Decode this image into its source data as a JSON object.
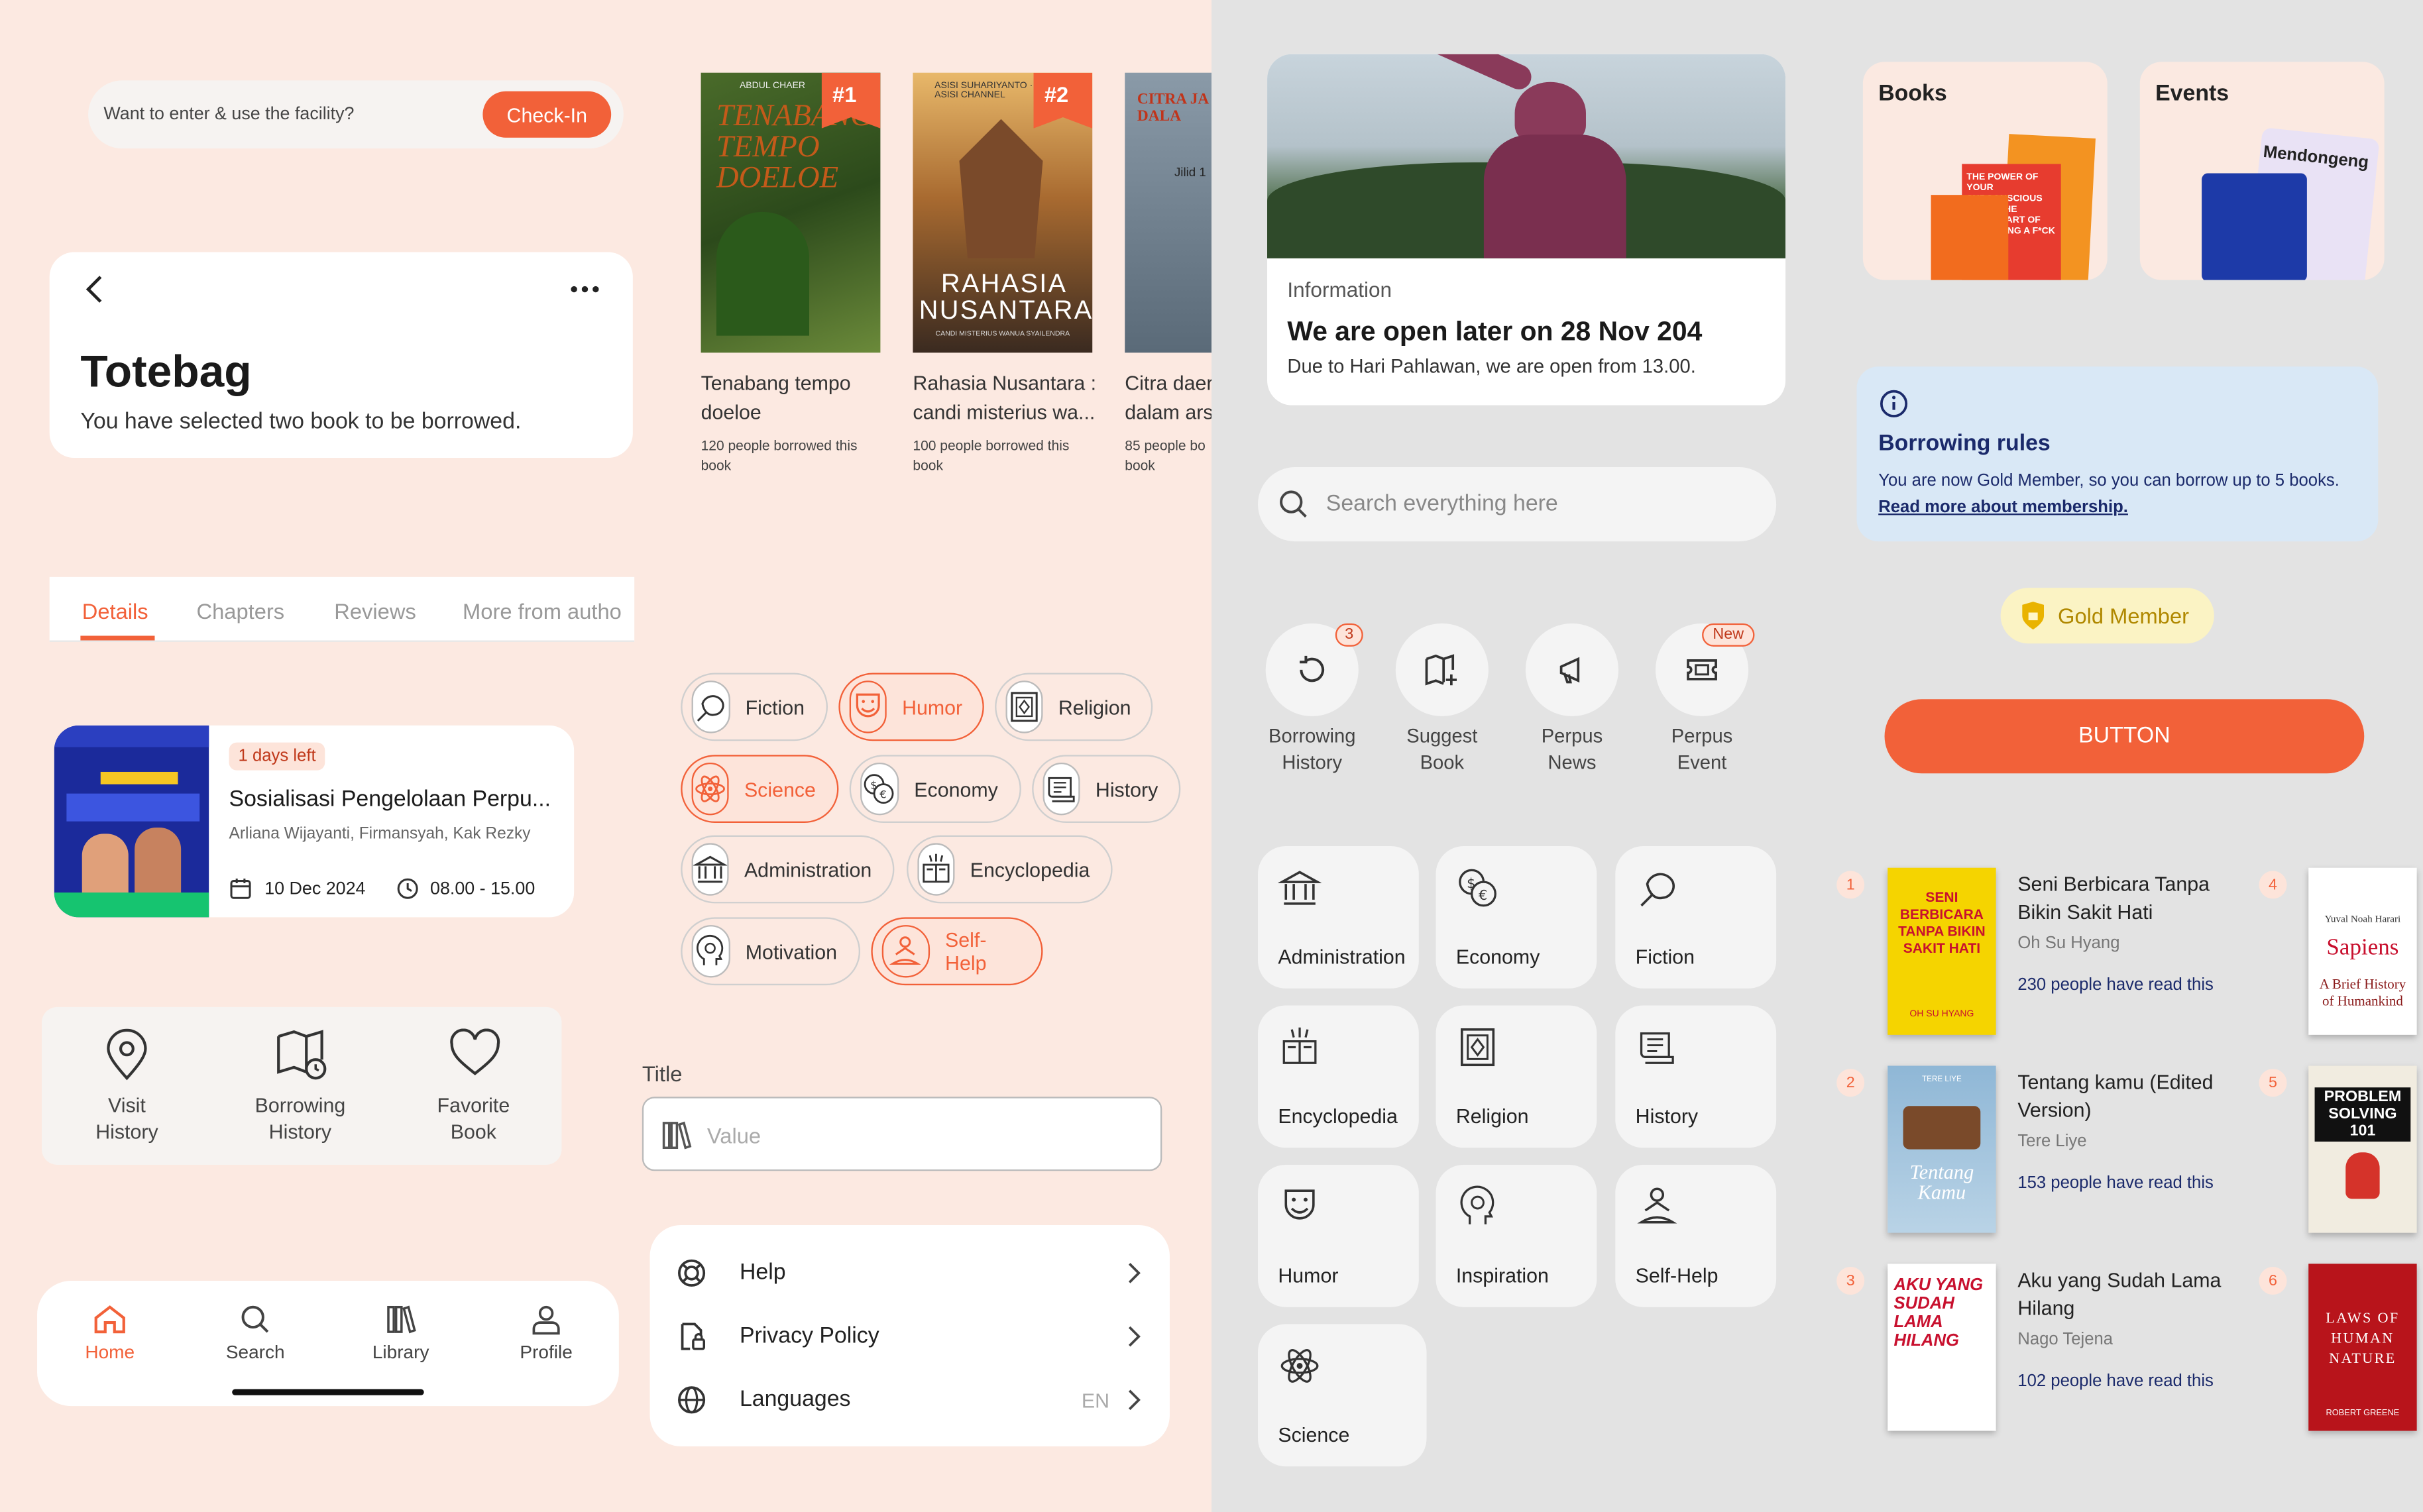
{
  "checkin": {
    "prompt": "Want to enter & use the facility?",
    "button": "Check-In"
  },
  "totebag": {
    "title": "Totebag",
    "subtitle": "You have selected two book to be borrowed."
  },
  "tabs": [
    "Details",
    "Chapters",
    "Reviews",
    "More from autho"
  ],
  "event_card": {
    "badge": "1 days left",
    "title": "Sosialisasi Pengelolaan Perpu...",
    "speakers": "Arliana Wijayanti, Firmansyah, Kak Rezky",
    "date": "10 Dec 2024",
    "time": "08.00 - 15.00"
  },
  "quick_actions": [
    {
      "label1": "Visit",
      "label2": "History",
      "icon": "location-pin-icon"
    },
    {
      "label1": "Borrowing",
      "label2": "History",
      "icon": "book-clock-icon"
    },
    {
      "label1": "Favorite",
      "label2": "Book",
      "icon": "heart-icon"
    }
  ],
  "bottom_nav": [
    {
      "label": "Home",
      "icon": "home-icon",
      "active": true
    },
    {
      "label": "Search",
      "icon": "search-icon"
    },
    {
      "label": "Library",
      "icon": "library-icon"
    },
    {
      "label": "Profile",
      "icon": "profile-icon"
    }
  ],
  "top_books": [
    {
      "rank": "#1",
      "cover_author": "ABDUL CHAER",
      "cover_title": "TENABANG TEMPO DOELOE",
      "title1": "Tenabang tempo",
      "title2": "doeloe",
      "stat1": "120 people borrowed this",
      "stat2": "book"
    },
    {
      "rank": "#2",
      "cover_author": "ASISI SUHARIYANTO · ASISI CHANNEL",
      "cover_title": "RAHASIA NUSANTARA",
      "cover_sub": "CANDI MISTERIUS WANUA SYAILENDRA",
      "title1": "Rahasia Nusantara :",
      "title2": "candi misterius wa...",
      "stat1": "100 people borrowed this",
      "stat2": "book"
    },
    {
      "cover_title": "CITRA JA DALA",
      "cover_sub": "Jilid 1",
      "title1": "Citra daer",
      "title2": "dalam ars",
      "stat1": "85 people bo",
      "stat2": "book"
    }
  ],
  "categories_chips": [
    {
      "label": "Fiction",
      "icon": "fiction-icon"
    },
    {
      "label": "Humor",
      "icon": "humor-icon",
      "selected": true
    },
    {
      "label": "Religion",
      "icon": "religion-icon"
    },
    {
      "label": "Science",
      "icon": "science-icon",
      "selected": true
    },
    {
      "label": "Economy",
      "icon": "economy-icon"
    },
    {
      "label": "History",
      "icon": "history-icon"
    },
    {
      "label": "Administration",
      "icon": "administration-icon"
    },
    {
      "label": "Encyclopedia",
      "icon": "encyclopedia-icon"
    },
    {
      "label": "Motivation",
      "icon": "motivation-icon"
    },
    {
      "label": "Self-Help",
      "icon": "self-help-icon",
      "selected": true
    }
  ],
  "title_field": {
    "label": "Title",
    "placeholder": "Value"
  },
  "settings": [
    {
      "label": "Help",
      "icon": "help-icon"
    },
    {
      "label": "Privacy Policy",
      "icon": "privacy-icon"
    },
    {
      "label": "Languages",
      "icon": "globe-icon",
      "value": "EN"
    }
  ],
  "info_card": {
    "kicker": "Information",
    "title": "We are open later on 28 Nov 204",
    "desc": "Due to Hari Pahlawan, we are open from 13.00."
  },
  "search": {
    "placeholder": "Search everything here"
  },
  "menu": [
    {
      "label1": "Borrowing",
      "label2": "History",
      "icon": "history-rotate-icon",
      "badge": "3"
    },
    {
      "label1": "Suggest",
      "label2": "Book",
      "icon": "suggest-book-icon"
    },
    {
      "label1": "Perpus",
      "label2": "News",
      "icon": "megaphone-icon"
    },
    {
      "label1": "Perpus",
      "label2": "Event",
      "icon": "ticket-icon",
      "badge": "New"
    }
  ],
  "category_tiles": [
    {
      "label": "Administration",
      "icon": "administration-icon"
    },
    {
      "label": "Economy",
      "icon": "economy-icon"
    },
    {
      "label": "Fiction",
      "icon": "fiction-icon"
    },
    {
      "label": "Encyclopedia",
      "icon": "encyclopedia-icon"
    },
    {
      "label": "Religion",
      "icon": "religion-icon"
    },
    {
      "label": "History",
      "icon": "history-icon"
    },
    {
      "label": "Humor",
      "icon": "humor-icon"
    },
    {
      "label": "Inspiration",
      "icon": "inspiration-icon"
    },
    {
      "label": "Self-Help",
      "icon": "self-help-icon"
    },
    {
      "label": "Science",
      "icon": "science-icon"
    }
  ],
  "promo": [
    {
      "label": "Books",
      "cover_text": "THE POWER OF YOUR SUBCONSCIOUS MIND · THE SUBTLE ART OF NOT GIVING A F*CK"
    },
    {
      "label": "Events",
      "cover_text": "Mendongeng"
    }
  ],
  "rules": {
    "title": "Borrowing rules",
    "body": "You are now Gold Member, so you can borrow up to 5 books.",
    "link": "Read more about membership."
  },
  "gold": {
    "label": "Gold Member"
  },
  "cta": {
    "label": "BUTTON"
  },
  "ranking": [
    {
      "n": "1",
      "title1": "Seni Berbicara Tanpa",
      "title2": "Bikin Sakit Hati",
      "author": "Oh Su Hyang",
      "reads": "230 people have read this",
      "cover": "SENI BERBICARA TANPA BIKIN SAKIT HATI",
      "cover_author": "OH SU HYANG"
    },
    {
      "n": "2",
      "title1": "Tentang kamu (Edited",
      "title2": "Version)",
      "author": "Tere Liye",
      "reads": "153 people have read this",
      "cover": "Tentang Kamu",
      "cover_author": "TERE LIYE"
    },
    {
      "n": "3",
      "title1": "Aku yang Sudah Lama",
      "title2": "Hilang",
      "author": "Nago Tejena",
      "reads": "102 people have read this",
      "cover": "AKU YANG SUDAH LAMA HILANG"
    }
  ],
  "ranking_side": [
    {
      "n": "4",
      "cover": "Sapiens",
      "cover_sub": "A Brief History of Humankind",
      "cover_author": "Yuval Noah Harari"
    },
    {
      "n": "5",
      "cover": "PROBLEM SOLVING 101"
    },
    {
      "n": "6",
      "cover": "LAWS OF HUMAN NATURE",
      "cover_author": "ROBERT GREENE"
    }
  ],
  "colors": {
    "accent": "#f26139",
    "accent_soft": "#fde4da",
    "left_bg": "#fce9e1",
    "right_bg": "#e3e3e3",
    "navy": "#1b2a6b",
    "gold": "#e9b300"
  }
}
